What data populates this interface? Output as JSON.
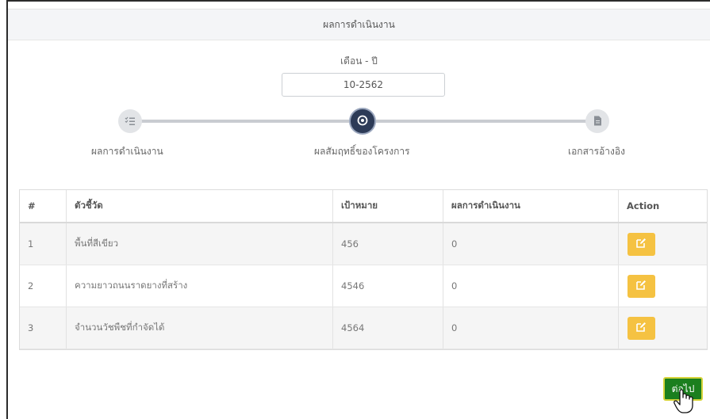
{
  "header": {
    "title": "ผลการดำเนินงาน"
  },
  "period": {
    "label": "เดือน - ปี",
    "value": "10-2562"
  },
  "stepper": {
    "steps": [
      {
        "label": "ผลการดำเนินงาน",
        "icon": "list-check-icon",
        "active": false
      },
      {
        "label": "ผลสัมฤทธิ์ของโครงการ",
        "icon": "target-icon",
        "active": true
      },
      {
        "label": "เอกสารอ้างอิง",
        "icon": "document-icon",
        "active": false
      }
    ]
  },
  "table": {
    "columns": [
      "#",
      "ตัวชี้วัด",
      "เป้าหมาย",
      "ผลการดำเนินงาน",
      "Action"
    ],
    "rows": [
      {
        "no": "1",
        "indicator": "พื้นที่สีเขียว",
        "target": "456",
        "result": "0"
      },
      {
        "no": "2",
        "indicator": "ความยาวถนนราดยางที่สร้าง",
        "target": "4546",
        "result": "0"
      },
      {
        "no": "3",
        "indicator": "จำนวนวัชพืชที่กำจัดได้",
        "target": "4564",
        "result": "0"
      }
    ]
  },
  "next_button": {
    "label": "ต่อไป"
  },
  "colors": {
    "edit_button": "#f5c242",
    "next_button": "#1b7f1e",
    "active_step": "#2d3b57"
  }
}
